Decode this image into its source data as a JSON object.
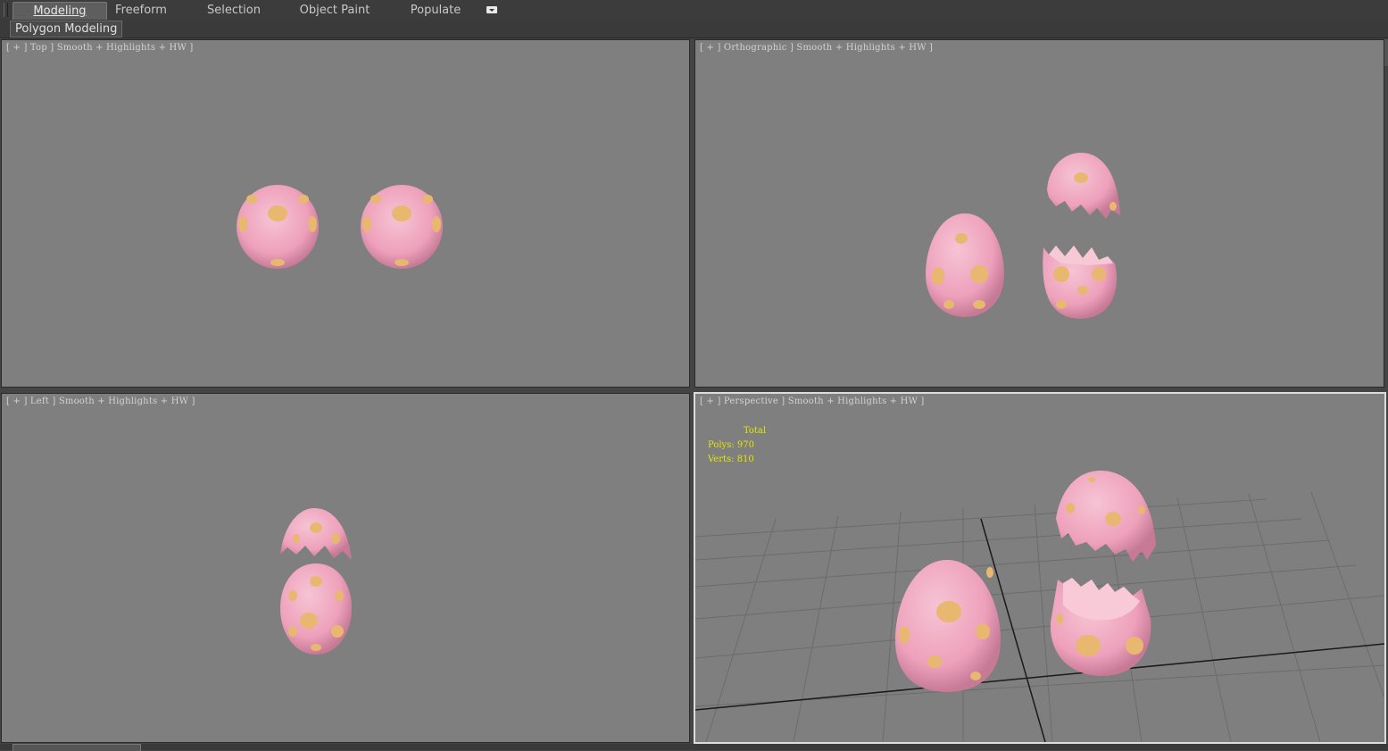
{
  "ribbon": {
    "tabs": [
      {
        "label": "Modeling",
        "active": true
      },
      {
        "label": "Freeform",
        "active": false
      },
      {
        "label": "Selection",
        "active": false
      },
      {
        "label": "Object Paint",
        "active": false
      },
      {
        "label": "Populate",
        "active": false
      }
    ],
    "dropdown_icon": "ribbon-options-icon"
  },
  "subbar": {
    "panel_label": "Polygon Modeling"
  },
  "viewports": {
    "top": {
      "label": "[ + ] Top ] Smooth + Highlights + HW ]"
    },
    "ortho": {
      "label": "[ + ] Orthographic ] Smooth + Highlights + HW ]"
    },
    "left": {
      "label": "[ + ] Left ] Smooth + Highlights + HW ]"
    },
    "persp": {
      "label": "[ + ] Perspective ] Smooth + Highlights + HW ]",
      "stats": {
        "header": "Total",
        "polys": "Polys: 970",
        "verts": "Verts: 810"
      }
    }
  },
  "colors": {
    "viewport_bg": "#7f7f7f",
    "egg_pink": "#f0a8c0",
    "egg_spot": "#e8b870",
    "stats_yellow": "#e6e600"
  }
}
